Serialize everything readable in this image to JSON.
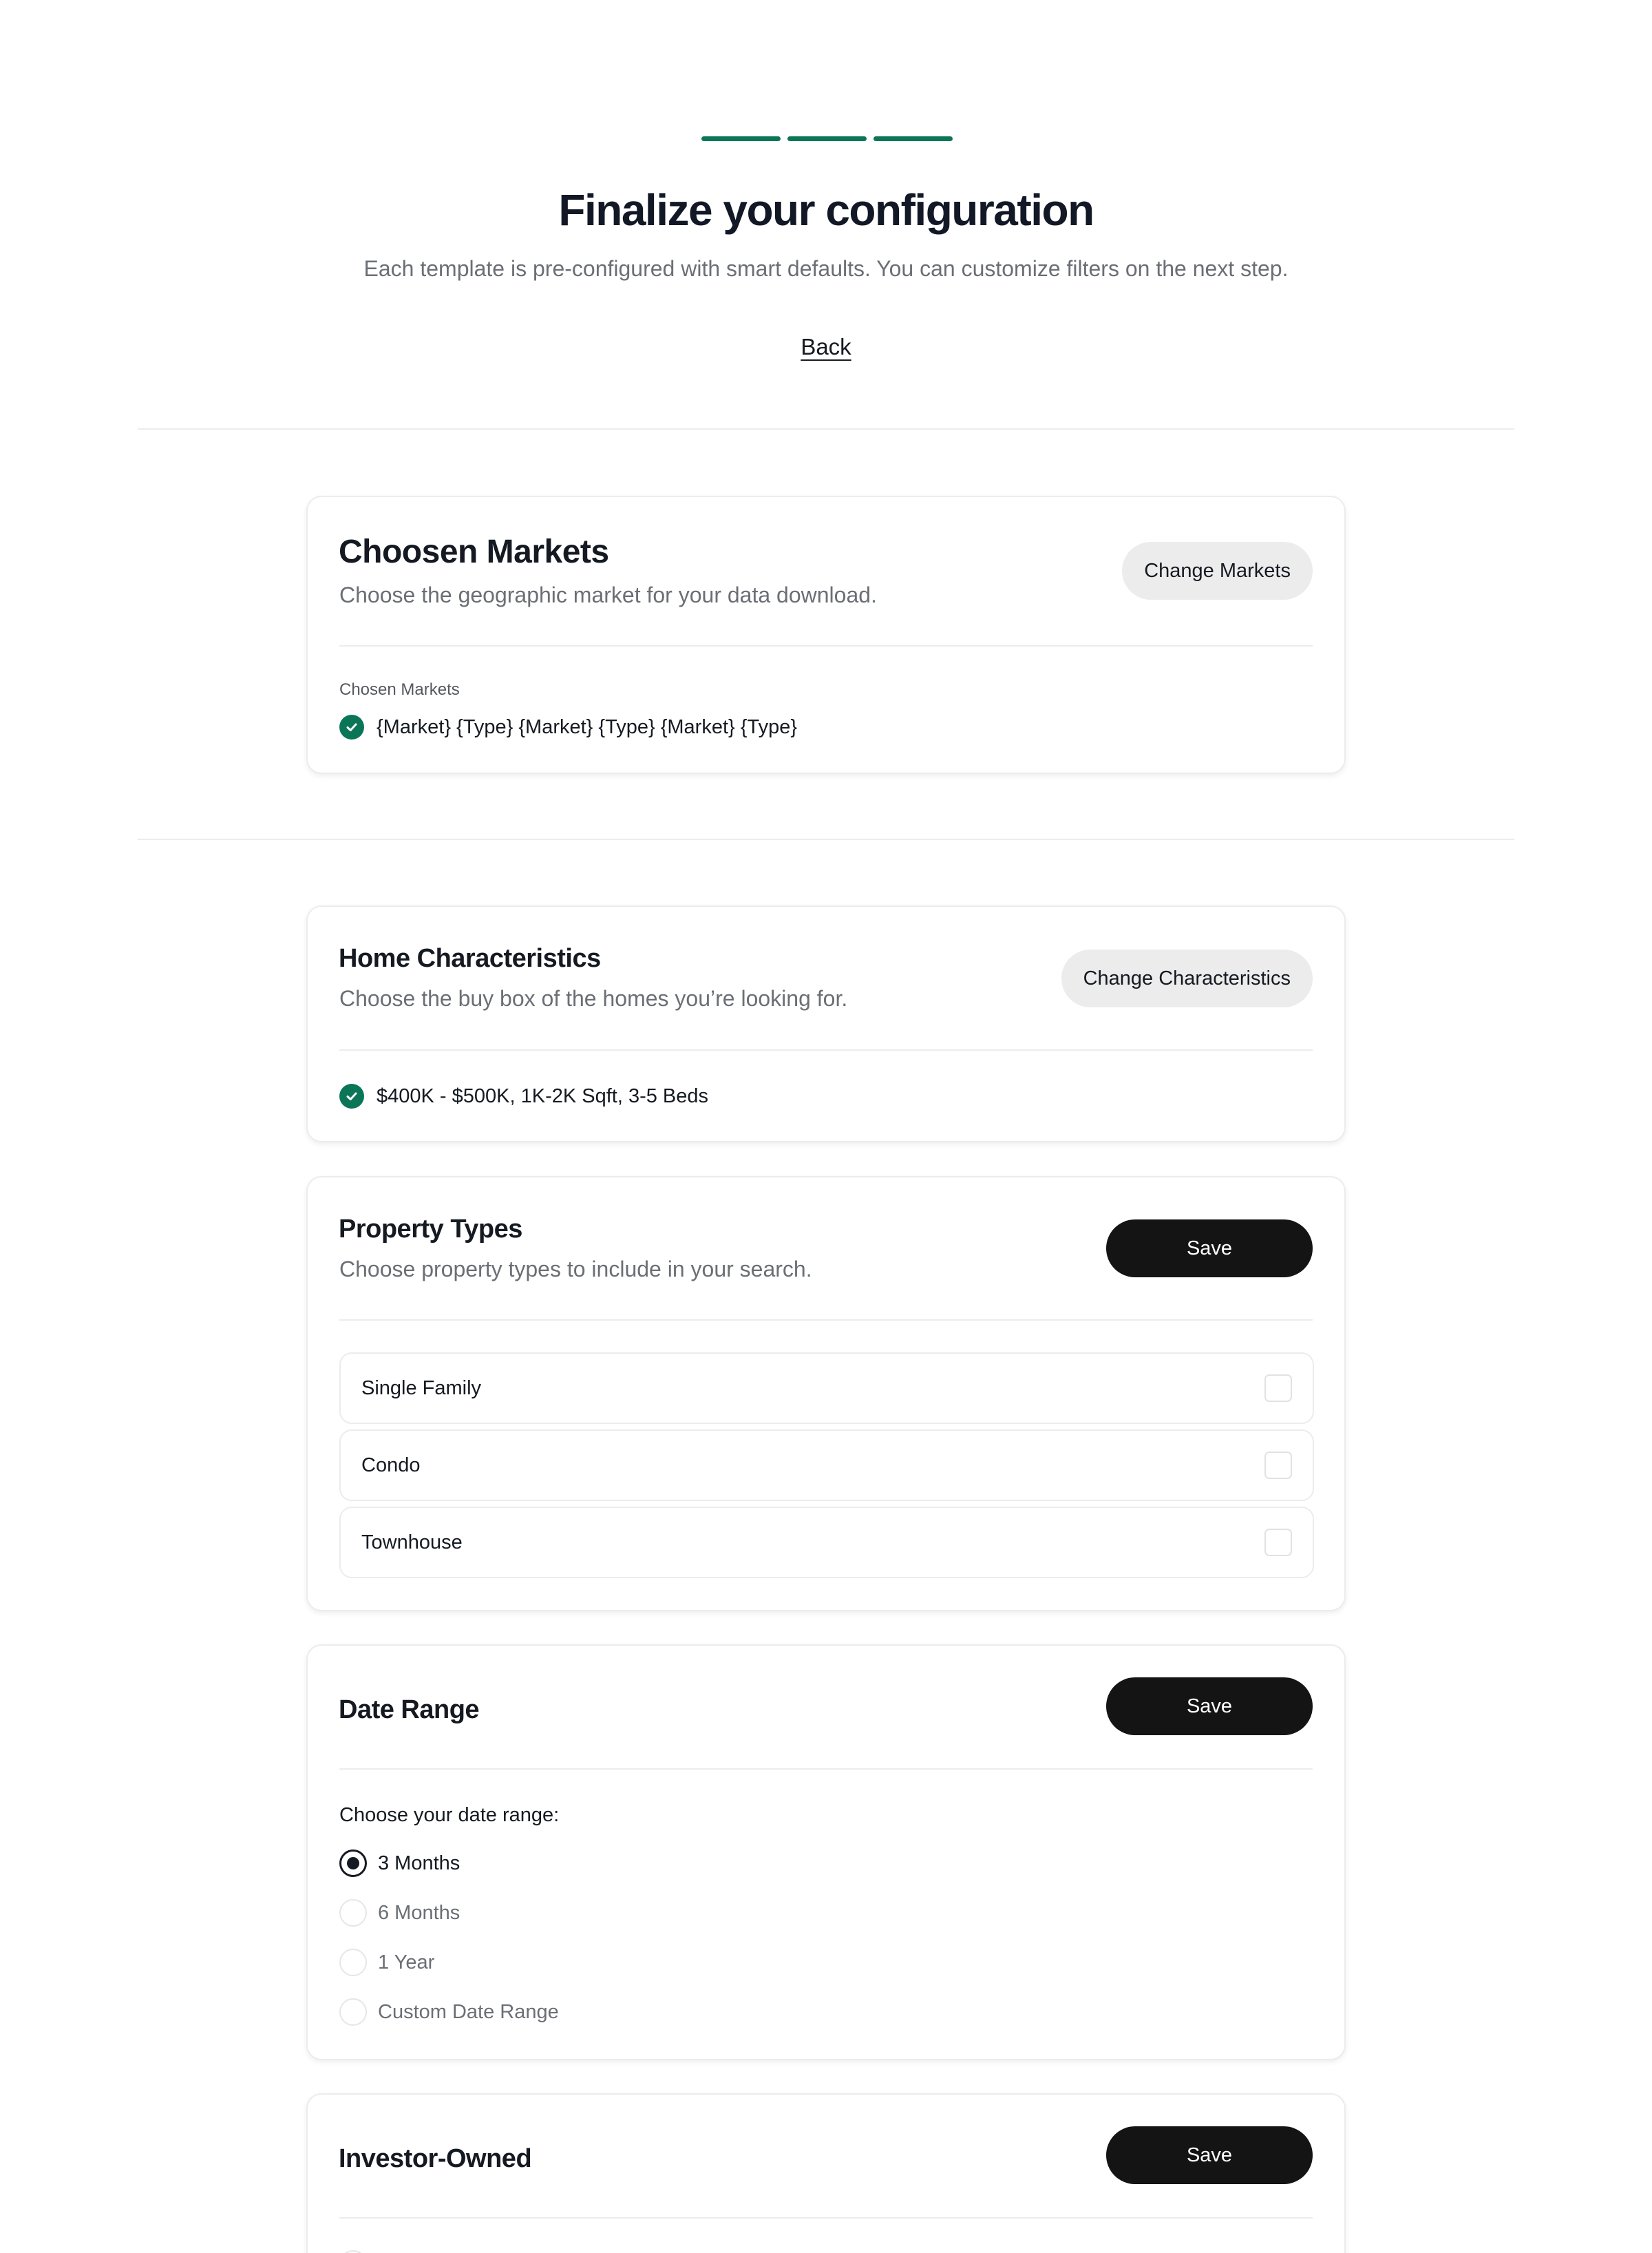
{
  "header": {
    "progress_steps": 3,
    "title": "Finalize your configuration",
    "subtitle": "Each template is pre-configured with smart defaults. You can customize filters on the next step.",
    "back_label": "Back"
  },
  "colors": {
    "accent": "#0b7657",
    "dark_button": "#141414",
    "light_button": "#ececec"
  },
  "markets": {
    "title": "Choosen Markets",
    "description": "Choose the geographic market for your data download.",
    "button_label": "Change Markets",
    "chosen_label": "Chosen Markets",
    "chosen_value": "{Market} {Type} {Market} {Type} {Market} {Type}"
  },
  "home": {
    "title": "Home Characteristics",
    "description": "Choose the buy box of the homes you’re looking for.",
    "button_label": "Change Characteristics",
    "summary": "$400K - $500K, 1K-2K Sqft, 3-5 Beds"
  },
  "property_types": {
    "title": "Property Types",
    "description": "Choose property types to include in your search.",
    "save_label": "Save",
    "options": [
      {
        "label": "Single Family",
        "checked": false
      },
      {
        "label": "Condo",
        "checked": false
      },
      {
        "label": "Townhouse",
        "checked": false
      }
    ]
  },
  "date_range": {
    "title": "Date Range",
    "save_label": "Save",
    "prompt": "Choose your date range:",
    "selected": "3 Months",
    "options": [
      "3 Months",
      "6 Months",
      "1 Year",
      "Custom Date Range"
    ]
  },
  "investor": {
    "title": "Investor-Owned",
    "save_label": "Save"
  }
}
